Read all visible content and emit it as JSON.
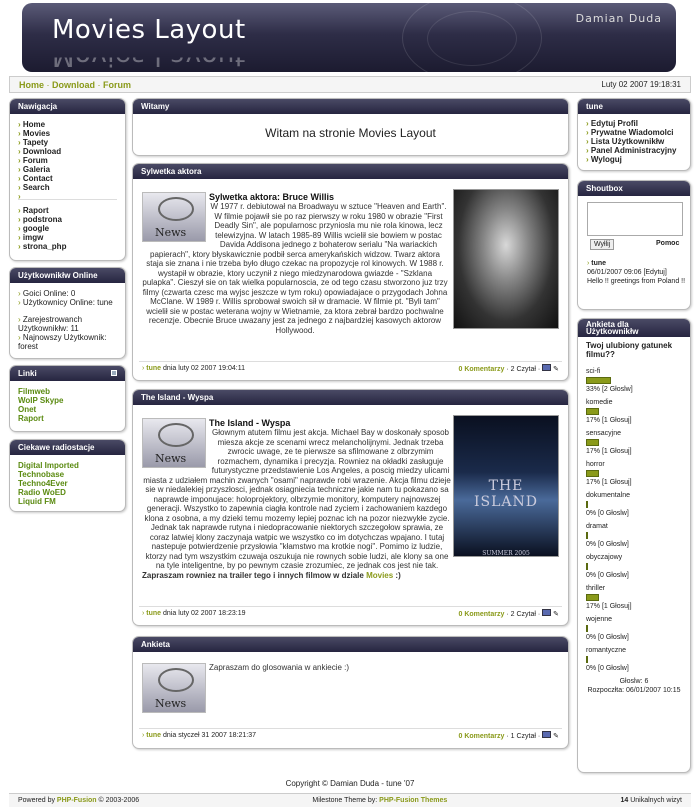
{
  "header": {
    "title": "Movies Layout",
    "author": "Damian Duda"
  },
  "navbar": {
    "links": [
      "Home",
      "Download",
      "Forum"
    ],
    "date": "Luty 02 2007 19:18:31"
  },
  "nav": {
    "title": "Nawigacja",
    "items": [
      "Home",
      "Movies",
      "Tapety",
      "Download",
      "Forum",
      "Galeria",
      "Contact",
      "Search"
    ],
    "items2": [
      "Raport",
      "podstrona",
      "google",
      "imgw",
      "strona_php"
    ]
  },
  "users": {
    "title": "Użytkownikłw Online",
    "lines": [
      "Goici Online: 0",
      "Użytkownicy Online: tune",
      "Zarejestrowanch Użytkownikłw: 11",
      "Najnowszy Użytkownik: forest"
    ]
  },
  "links": {
    "title": "Linki",
    "items": [
      "Filmweb",
      "WoIP Skype",
      "Onet",
      "Raport"
    ]
  },
  "radio": {
    "title": "Ciekawe radiostacje",
    "items": [
      "Digital Imported",
      "Technobase",
      "Techno4Ever",
      "Radio WoED",
      "Liquid FM"
    ]
  },
  "welcome": {
    "title": "Witamy",
    "text": "Witam na stronie Movies Layout"
  },
  "article1": {
    "section": "Sylwetka aktora",
    "title": "Sylwetka aktora: Bruce Willis",
    "body": "W 1977 r. debiutował na Broadwayu w sztuce \"Heaven and Earth\". W filmie pojawił sie po raz pierwszy w roku 1980 w obrazie \"First Deadly Sin\", ale popularnosc przyniosla mu nie rola kinowa, lecz telewizyjna. W latach 1985-89 Willis wcielił sie bowiem w postac Davida Addisona jednego z bohaterow serialu \"Na wariackich papierach\", ktory błyskawicznie podbił serca amerykańskich widzow. Twarz aktora staja sie znana i nie trzeba było długo czekac na propozycje rol kinowych. W 1988 r. wystapił w obrazie, ktory uczynił z niego miedzynarodowa gwiazde - \"Szklana pulapka\". Cieszył sie on tak wielka popularnoscia, ze od tego czasu stworzono juz trzy filmy (czwarta czesc ma wyjsc jeszcze w tym roku) opowiadajace o przygodach Johna McClane. W 1989 r. Willis sprobował swoich sił w dramacie. W filmie pt. \"Byli tam\" wcielił sie w postac weterana wojny w Wietnamie, za ktora zebrał bardzo pochwalne recenzje. Obecnie Bruce uwazany jest za jednego z najbardziej kasowych aktorow Hollywood.",
    "user": "tune",
    "date": "dnia luty 02 2007 19:04:11",
    "comments": "0 Komentarzy",
    "reads": "2 Czytał"
  },
  "article2": {
    "section": "The Island - Wyspa",
    "title": "The Island - Wyspa",
    "body": "Głownym atutem filmu jest akcja. Michael Bay w doskonały sposob miesza akcje ze scenami wrecz melancholijnymi. Jednak trzeba zwrocic uwage, ze te pierwsze sa sfilmowane z olbrzymim rozmachem, dynamika i precyzja. Rowniez na okładki zasługuje futurystyczne przedstawienie Los Angeles, a poscig miedzy ulicami miasta z udziałem machin zwanych \"osami\" naprawde robi wrazenie. Akcja filmu dzieje sie w niedalekiej przyszłosci, jednak osiagniecia techniczne jakie nam tu pokazano sa naprawde imponujace: holoprojektory, olbrzymie monitory, komputery najnowszej generacji. Wszystko to zapewnia ciagła kontrole nad zyciem i zachowaniem kazdego klona z osobna, a my dzieki temu mozemy lepiej poznac ich na pozor niezwykłe zycie. Jednak tak naprawde rutyna i niedopracowanie niektorych szczegołow sprawia, ze coraz latwiej klony zaczynaja watpic we wszystko co im dotychczas wpajano. I tutaj nastepuje potwierdzenie przysłowia \"kłamstwo ma krotkie nogi\". Pomimo iz ludzie, ktorzy nad tym wszystkim czuwaja oszukuja nie rownych sobie ludzi, ale klony sa one na tyle inteligentne, by po pewnym czasie zrozumiec, ze jednak cos jest nie tak.",
    "footer": "Zapraszam rowniez na trailer tego i innych filmow w dziale",
    "footer_link": "Movies",
    "footer_tail": ":)",
    "poster_title": "THE ISLAND",
    "poster_date": "SUMMER 2005",
    "user": "tune",
    "date": "dnia luty 02 2007 18:23:19",
    "comments": "0 Komentarzy",
    "reads": "2 Czytał"
  },
  "article3": {
    "section": "Ankieta",
    "body": "Zapraszam do glosowania w ankiecie :)",
    "user": "tune",
    "date": "dnia styczeł 31 2007 18:21:37",
    "comments": "0 Komentarzy",
    "reads": "1 Czytał"
  },
  "news_label": "News",
  "userbox": {
    "title": "tune",
    "items": [
      "Edytuj Profil",
      "Prywatne Wiadomolci",
      "Lista Użytkownikłw",
      "Panel Administracyjny",
      "Wyloguj"
    ]
  },
  "shoutbox": {
    "title": "Shoutbox",
    "send": "Wyłlij",
    "help": "Pomoc",
    "user": "tune",
    "meta": "06/01/2007 09:06 [Edytuj]",
    "msg": "Hello !! greetings from Poland !!"
  },
  "poll": {
    "title": "Ankieta dla Użytkownikłw",
    "question": "Twoj ulubiony gatunek filmu??",
    "options": [
      {
        "label": "sci-fi",
        "pct": 33,
        "text": "33% [2 Głoslw]"
      },
      {
        "label": "komedie",
        "pct": 17,
        "text": "17% [1 Głosuj]"
      },
      {
        "label": "sensacyjne",
        "pct": 17,
        "text": "17% [1 Głosuj]"
      },
      {
        "label": "horror",
        "pct": 17,
        "text": "17% [1 Głosuj]"
      },
      {
        "label": "dokumentalne",
        "pct": 0,
        "text": "0% [0 Głoslw]"
      },
      {
        "label": "dramat",
        "pct": 0,
        "text": "0% [0 Głoslw]"
      },
      {
        "label": "obyczajowy",
        "pct": 0,
        "text": "0% [0 Głoslw]"
      },
      {
        "label": "thriller",
        "pct": 17,
        "text": "17% [1 Głosuj]"
      },
      {
        "label": "wojenne",
        "pct": 0,
        "text": "0% [0 Głoslw]"
      },
      {
        "label": "romantyczne",
        "pct": 0,
        "text": "0% [0 Głoslw]"
      }
    ],
    "votes": "Głoslw: 6",
    "start": "Rozpoczłta: 06/01/2007 10:15"
  },
  "footer": {
    "copyright": "Copyright © Damian Duda - tune '07",
    "powered_pre": "Powered by",
    "powered_link": "PHP-Fusion",
    "powered_post": "© 2003-2006",
    "theme_pre": "Milestone Theme by:",
    "theme_link": "PHP-Fusion Themes",
    "visits_num": "14",
    "visits_text": "Unikalnych wizyt"
  }
}
